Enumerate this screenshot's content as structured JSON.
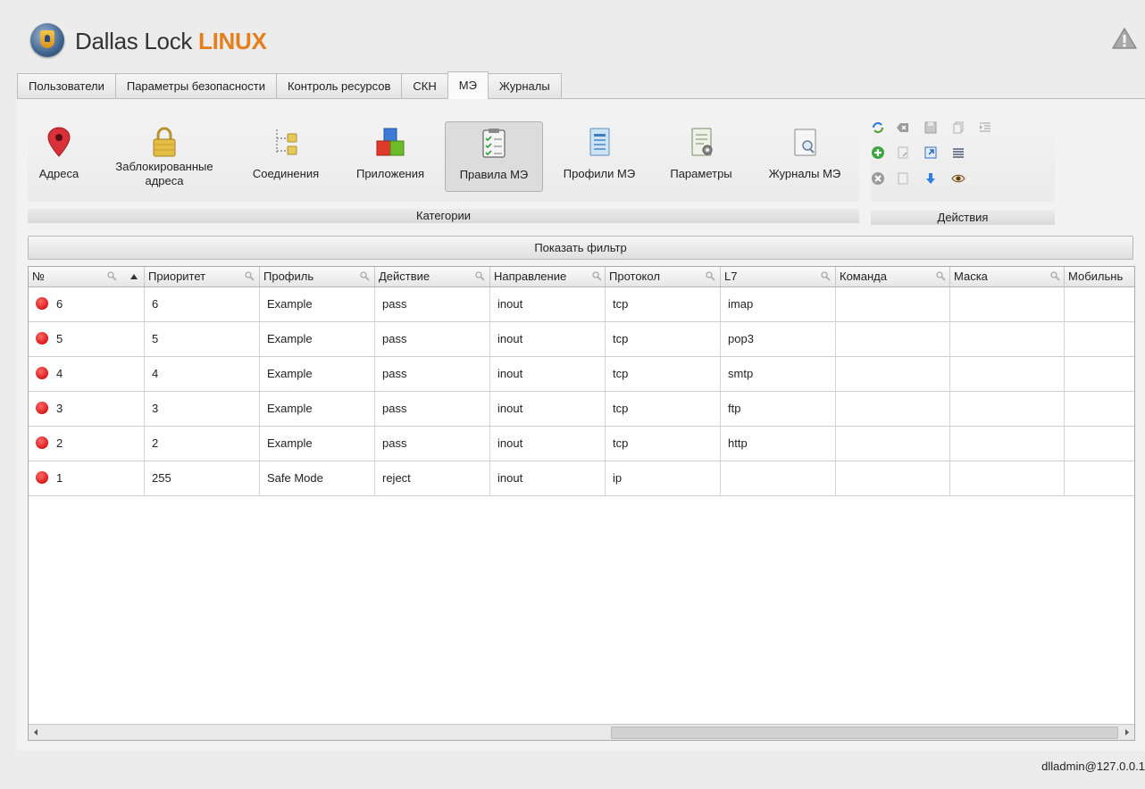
{
  "app": {
    "logo_text": "Dallas Lock ",
    "logo_accent": "LINUX"
  },
  "tabs": [
    {
      "label": "Пользователи",
      "active": false
    },
    {
      "label": "Параметры безопасности",
      "active": false
    },
    {
      "label": "Контроль ресурсов",
      "active": false
    },
    {
      "label": "СКН",
      "active": false
    },
    {
      "label": "МЭ",
      "active": true
    },
    {
      "label": "Журналы",
      "active": false
    }
  ],
  "categories": {
    "group_label": "Категории",
    "items": [
      {
        "label": "Адреса",
        "icon": "map-pin-icon"
      },
      {
        "label": "Заблокированные адреса",
        "icon": "padlock-icon"
      },
      {
        "label": "Соединения",
        "icon": "tree-connections-icon"
      },
      {
        "label": "Приложения",
        "icon": "blocks-icon"
      },
      {
        "label": "Правила МЭ",
        "icon": "clipboard-checklist-icon",
        "active": true
      },
      {
        "label": "Профили МЭ",
        "icon": "document-icon"
      },
      {
        "label": "Параметры",
        "icon": "settings-document-icon"
      },
      {
        "label": "Журналы МЭ",
        "icon": "log-search-icon"
      }
    ]
  },
  "actions": {
    "group_label": "Действия",
    "icons": [
      "refresh-icon",
      "clear-icon",
      "save-icon",
      "copy-icon",
      "indent-icon",
      "add-icon",
      "doc-edit-icon",
      "external-link-icon",
      "list-icon",
      "delete-icon",
      "doc-icon",
      "move-down-icon",
      "view-icon"
    ]
  },
  "filter": {
    "label": "Показать фильтр"
  },
  "table": {
    "columns": [
      "№",
      "Приоритет",
      "Профиль",
      "Действие",
      "Направление",
      "Протокол",
      "L7",
      "Команда",
      "Маска",
      "Мобильнь"
    ],
    "rows": [
      {
        "status": "red",
        "cells": [
          "6",
          "6",
          "Example",
          "pass",
          "inout",
          "tcp",
          "imap",
          "",
          "",
          ""
        ]
      },
      {
        "status": "red",
        "cells": [
          "5",
          "5",
          "Example",
          "pass",
          "inout",
          "tcp",
          "pop3",
          "",
          "",
          ""
        ]
      },
      {
        "status": "red",
        "cells": [
          "4",
          "4",
          "Example",
          "pass",
          "inout",
          "tcp",
          "smtp",
          "",
          "",
          ""
        ]
      },
      {
        "status": "red",
        "cells": [
          "3",
          "3",
          "Example",
          "pass",
          "inout",
          "tcp",
          "ftp",
          "",
          "",
          ""
        ]
      },
      {
        "status": "red",
        "cells": [
          "2",
          "2",
          "Example",
          "pass",
          "inout",
          "tcp",
          "http",
          "",
          "",
          ""
        ]
      },
      {
        "status": "red",
        "cells": [
          "1",
          "255",
          "Safe Mode",
          "reject",
          "inout",
          "ip",
          "",
          "",
          "",
          ""
        ]
      }
    ]
  },
  "status_bar": {
    "user": "dlladmin@127.0.0.1"
  },
  "colors": {
    "accent": "#e47f1c",
    "status_red": "#d91a1a"
  }
}
